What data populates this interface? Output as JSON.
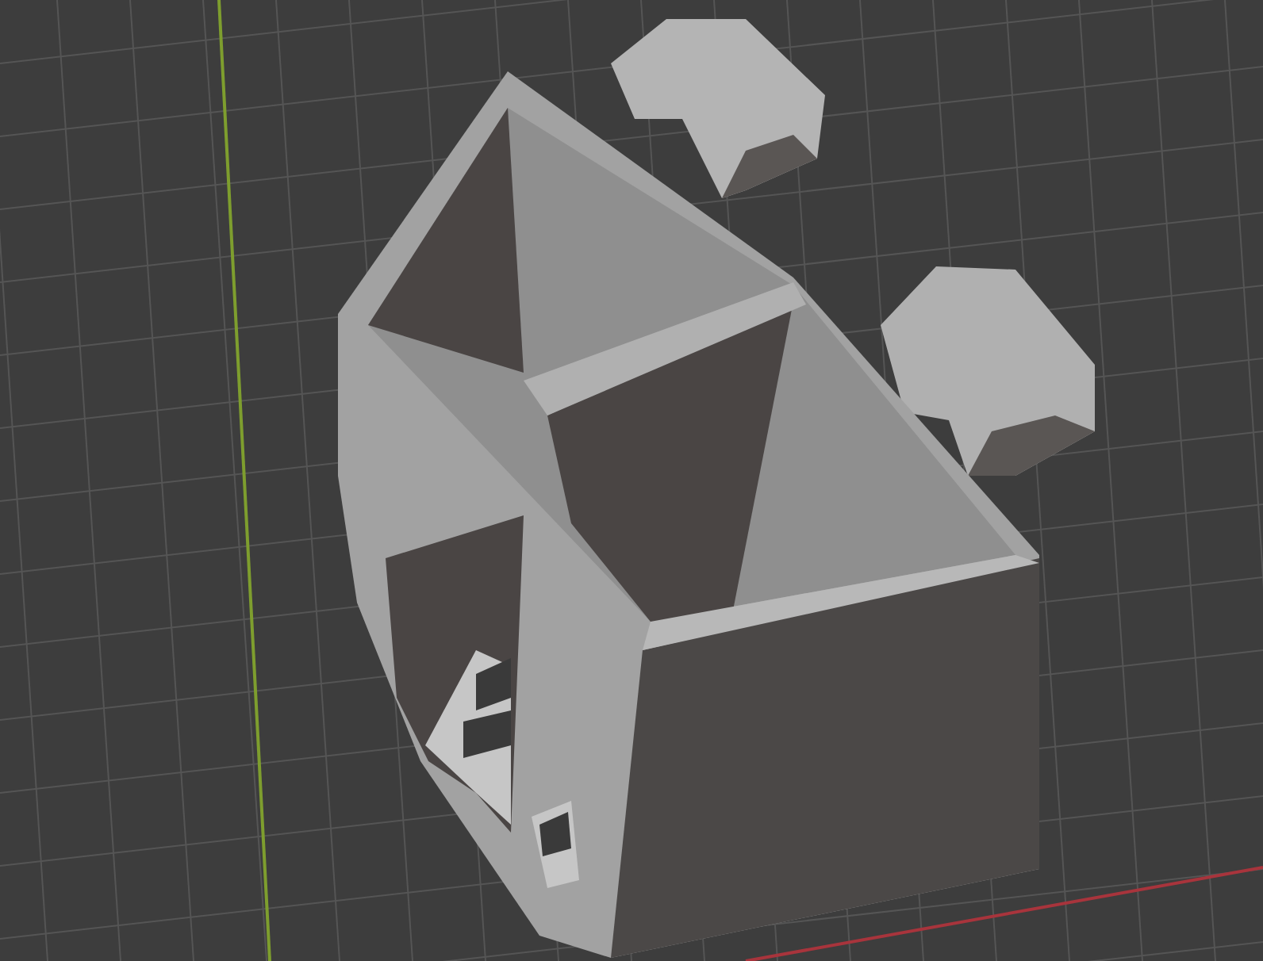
{
  "viewport": {
    "axes": [
      {
        "kind": "y",
        "color": "#7e9e2e"
      },
      {
        "kind": "x",
        "color": "#a8343c"
      }
    ]
  }
}
